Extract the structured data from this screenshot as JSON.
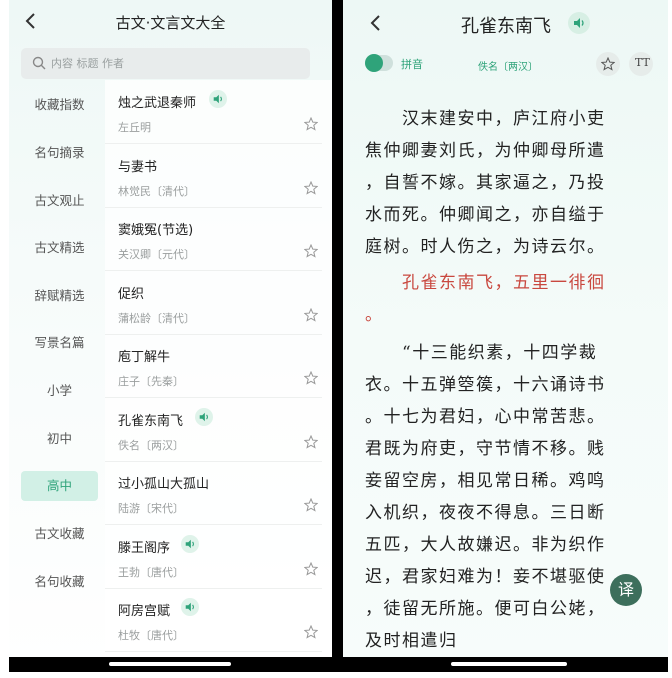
{
  "left": {
    "title": "古文·文言文大全",
    "search_placeholder": "内容 标题 作者",
    "categories": [
      {
        "label": "收藏指数",
        "active": false
      },
      {
        "label": "名句摘录",
        "active": false
      },
      {
        "label": "古文观止",
        "active": false
      },
      {
        "label": "古文精选",
        "active": false
      },
      {
        "label": "辞赋精选",
        "active": false
      },
      {
        "label": "写景名篇",
        "active": false
      },
      {
        "label": "小学",
        "active": false
      },
      {
        "label": "初中",
        "active": false
      },
      {
        "label": "高中",
        "active": true
      },
      {
        "label": "古文收藏",
        "active": false
      },
      {
        "label": "名句收藏",
        "active": false
      }
    ],
    "works": [
      {
        "title": "烛之武退秦师",
        "author": "左丘明",
        "audio": true
      },
      {
        "title": "与妻书",
        "author": "林觉民〔清代〕",
        "audio": false
      },
      {
        "title": "窦娥冤(节选)",
        "author": "关汉卿〔元代〕",
        "audio": false
      },
      {
        "title": "促织",
        "author": "蒲松龄〔清代〕",
        "audio": false
      },
      {
        "title": "庖丁解牛",
        "author": "庄子〔先秦〕",
        "audio": false
      },
      {
        "title": "孔雀东南飞",
        "author": "佚名〔两汉〕",
        "audio": true
      },
      {
        "title": "过小孤山大孤山",
        "author": "陆游〔宋代〕",
        "audio": false
      },
      {
        "title": "滕王阁序",
        "author": "王勃〔唐代〕",
        "audio": true
      },
      {
        "title": "阿房宫赋",
        "author": "杜牧〔唐代〕",
        "audio": true
      }
    ]
  },
  "right": {
    "title": "孔雀东南飞",
    "pinyin_label": "拼音",
    "source": "佚名〔两汉〕",
    "font_button": "TT",
    "translate_button": "译",
    "lines": [
      {
        "text": "　　汉末建安中，庐江府小吏",
        "red": false
      },
      {
        "text": "焦仲卿妻刘氏，为仲卿母所遣",
        "red": false
      },
      {
        "text": "，自誓不嫁。其家逼之，乃投",
        "red": false
      },
      {
        "text": "水而死。仲卿闻之，亦自缢于",
        "red": false
      },
      {
        "text": "庭树。时人伤之，为诗云尔。",
        "red": false
      },
      {
        "text": "　　孔雀东南飞，五里一徘徊",
        "red": true
      },
      {
        "text": "。",
        "red": true
      },
      {
        "text": "　　“十三能织素，十四学裁",
        "red": false
      },
      {
        "text": "衣。十五弹箜篌，十六诵诗书",
        "red": false
      },
      {
        "text": "。十七为君妇，心中常苦悲。",
        "red": false
      },
      {
        "text": "君既为府吏，守节情不移。贱",
        "red": false
      },
      {
        "text": "妾留空房，相见常日稀。鸡鸣",
        "red": false
      },
      {
        "text": "入机织，夜夜不得息。三日断",
        "red": false
      },
      {
        "text": "五匹，大人故嫌迟。非为织作",
        "red": false
      },
      {
        "text": "迟，君家妇难为！妾不堪驱使",
        "red": false
      },
      {
        "text": "，徒留无所施。便可白公姥，",
        "red": false
      },
      {
        "text": "及时相遣归",
        "red": false
      }
    ]
  },
  "colors": {
    "accent": "#2fa37a",
    "highlight": "#c9483f",
    "active_bg": "#d2f0e6"
  }
}
